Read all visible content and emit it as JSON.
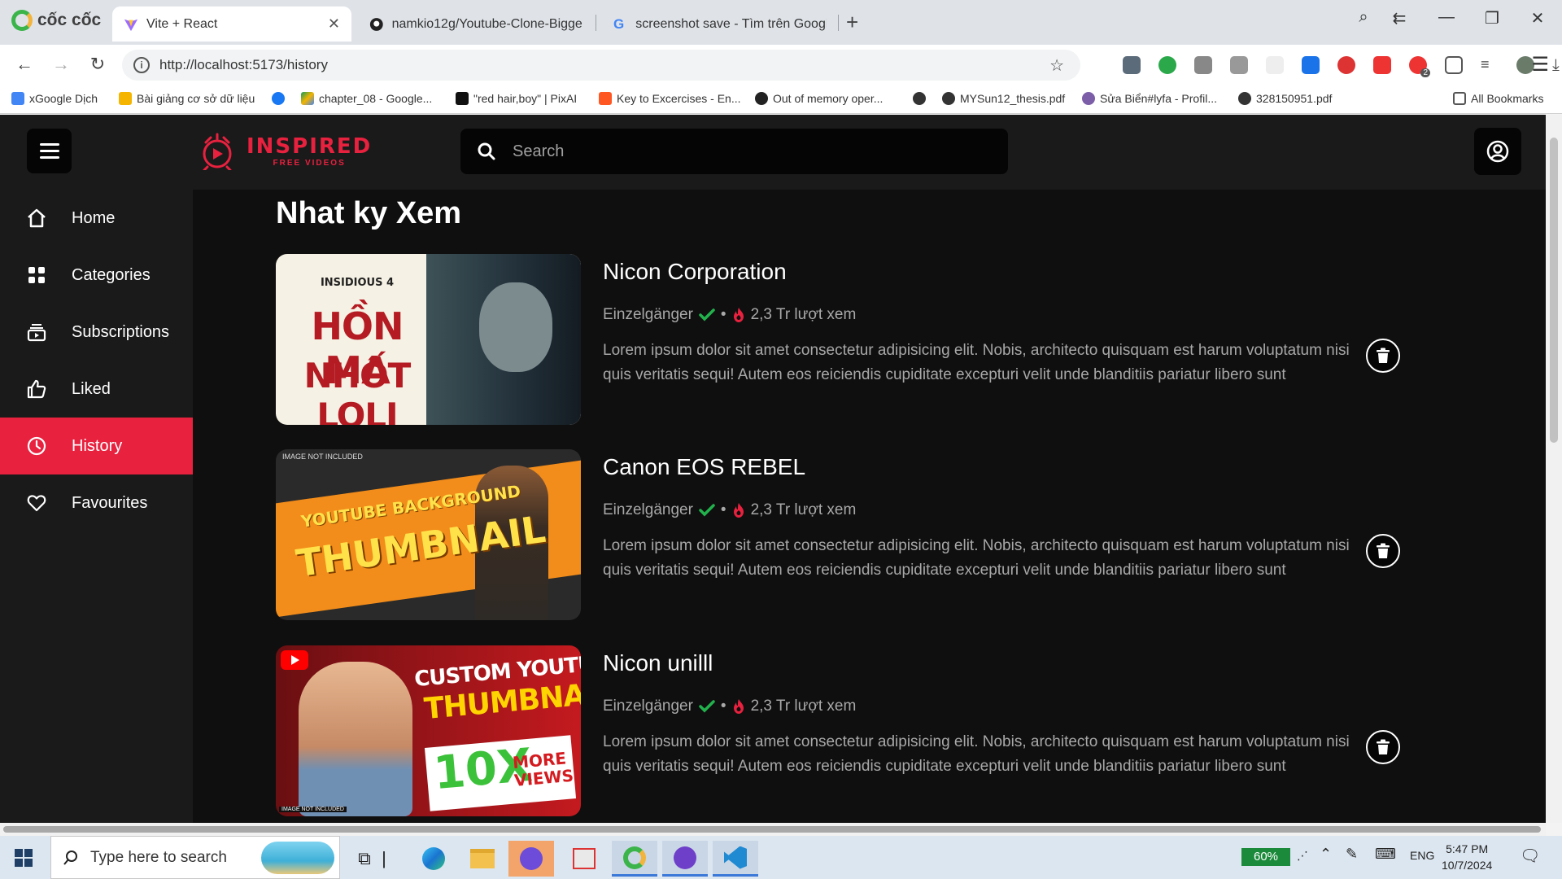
{
  "browser": {
    "name": "cốc cốc",
    "tabs": [
      {
        "label": "Vite + React"
      },
      {
        "label": "namkio12g/Youtube-Clone-Bigge"
      },
      {
        "label": "screenshot save - Tìm trên Googl"
      }
    ],
    "url": "http://localhost:5173/history",
    "bookmarks": [
      {
        "label": "xGoogle Dịch"
      },
      {
        "label": "Bài giảng cơ sở dữ liệu"
      },
      {
        "label": ""
      },
      {
        "label": "chapter_08 - Google..."
      },
      {
        "label": "\"red hair,boy\" | PixAI"
      },
      {
        "label": "Key to Excercises - En..."
      },
      {
        "label": "Out of memory oper..."
      },
      {
        "label": ""
      },
      {
        "label": "MYSun12_thesis.pdf"
      },
      {
        "label": "Sửa Biển#lyfa - Profil..."
      },
      {
        "label": "328150951.pdf"
      }
    ],
    "all_bookmarks": "All Bookmarks",
    "ext_badge": "2"
  },
  "app": {
    "brand_title": "INSPIRED",
    "brand_sub": "FREE VIDEOS",
    "search_placeholder": "Search",
    "accent": "#e8213f",
    "sidebar": [
      {
        "label": "Home",
        "icon": "home-icon"
      },
      {
        "label": "Categories",
        "icon": "grid-icon"
      },
      {
        "label": "Subscriptions",
        "icon": "subscriptions-icon"
      },
      {
        "label": "Liked",
        "icon": "thumbs-up-icon"
      },
      {
        "label": "History",
        "icon": "clock-icon",
        "active": true
      },
      {
        "label": "Favourites",
        "icon": "heart-icon"
      }
    ],
    "page_title": "Nhat ky Xem",
    "videos": [
      {
        "title": "Nicon Corporation",
        "channel": "Einzelgänger",
        "views": "2,3 Tr lượt xem",
        "description": "Lorem ipsum dolor sit amet consectetur adipisicing elit. Nobis, architecto quisquam est harum voluptatum nisi quis veritatis sequi! Autem eos reiciendis cupiditate excepturi velit unde blanditiis pariatur libero sunt",
        "thumb": {
          "line1": "INSIDIOUS 4",
          "line2": "HỒN MA",
          "line3": "NHỐT LOLI"
        }
      },
      {
        "title": "Canon EOS REBEL",
        "channel": "Einzelgänger",
        "views": "2,3 Tr lượt xem",
        "description": "Lorem ipsum dolor sit amet consectetur adipisicing elit. Nobis, architecto quisquam est harum voluptatum nisi quis veritatis sequi! Autem eos reiciendis cupiditate excepturi velit unde blanditiis pariatur libero sunt",
        "thumb": {
          "line0": "IMAGE NOT INCLUDED",
          "line1": "YOUTUBE BACKGROUND",
          "line2": "THUMBNAIL"
        }
      },
      {
        "title": "Nicon unilll",
        "channel": "Einzelgänger",
        "views": "2,3 Tr lượt xem",
        "description": "Lorem ipsum dolor sit amet consectetur adipisicing elit. Nobis, architecto quisquam est harum voluptatum nisi quis veritatis sequi! Autem eos reiciendis cupiditate excepturi velit unde blanditiis pariatur libero sunt",
        "thumb": {
          "line1": "CUSTOM YOUTUBE",
          "line2": "THUMBNAIL",
          "line3": "10X",
          "line4": "MORE VIEWS",
          "line5": "IMAGE NOT INCLUDED"
        }
      }
    ]
  },
  "taskbar": {
    "search_placeholder": "Type here to search",
    "battery": "60%",
    "language": "ENG",
    "time": "5:47 PM",
    "date": "10/7/2024"
  }
}
